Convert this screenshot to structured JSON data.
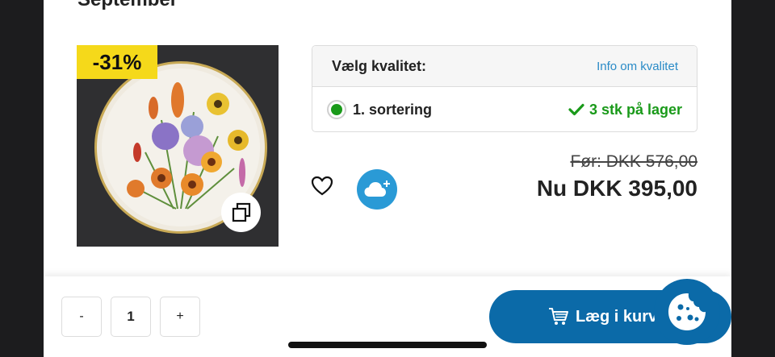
{
  "page": {
    "heading": "September"
  },
  "product": {
    "discount_badge": "-31%",
    "image_icon": "copy-icon"
  },
  "quality": {
    "title": "Vælg kvalitet:",
    "info_link": "Info om kvalitet",
    "selected_option": "1. sortering",
    "stock": "3 stk på lager"
  },
  "actions": {
    "favorite_icon": "heart-icon",
    "cloud_icon": "cloud-plus-icon"
  },
  "price": {
    "before": "Før: DKK 576,00",
    "now": "Nu DKK 395,00"
  },
  "cart": {
    "minus_label": "-",
    "quantity": "1",
    "plus_label": "+",
    "add_label": "Læg i kurv",
    "cart_icon": "shopping-cart-icon",
    "cookie_icon": "cookie-icon"
  },
  "colors": {
    "accent_blue": "#0b6aa8",
    "stock_green": "#1a9a1a",
    "badge_yellow": "#f5d91a",
    "cloud_blue": "#2a9ad6",
    "link_blue": "#2a8bc7"
  }
}
